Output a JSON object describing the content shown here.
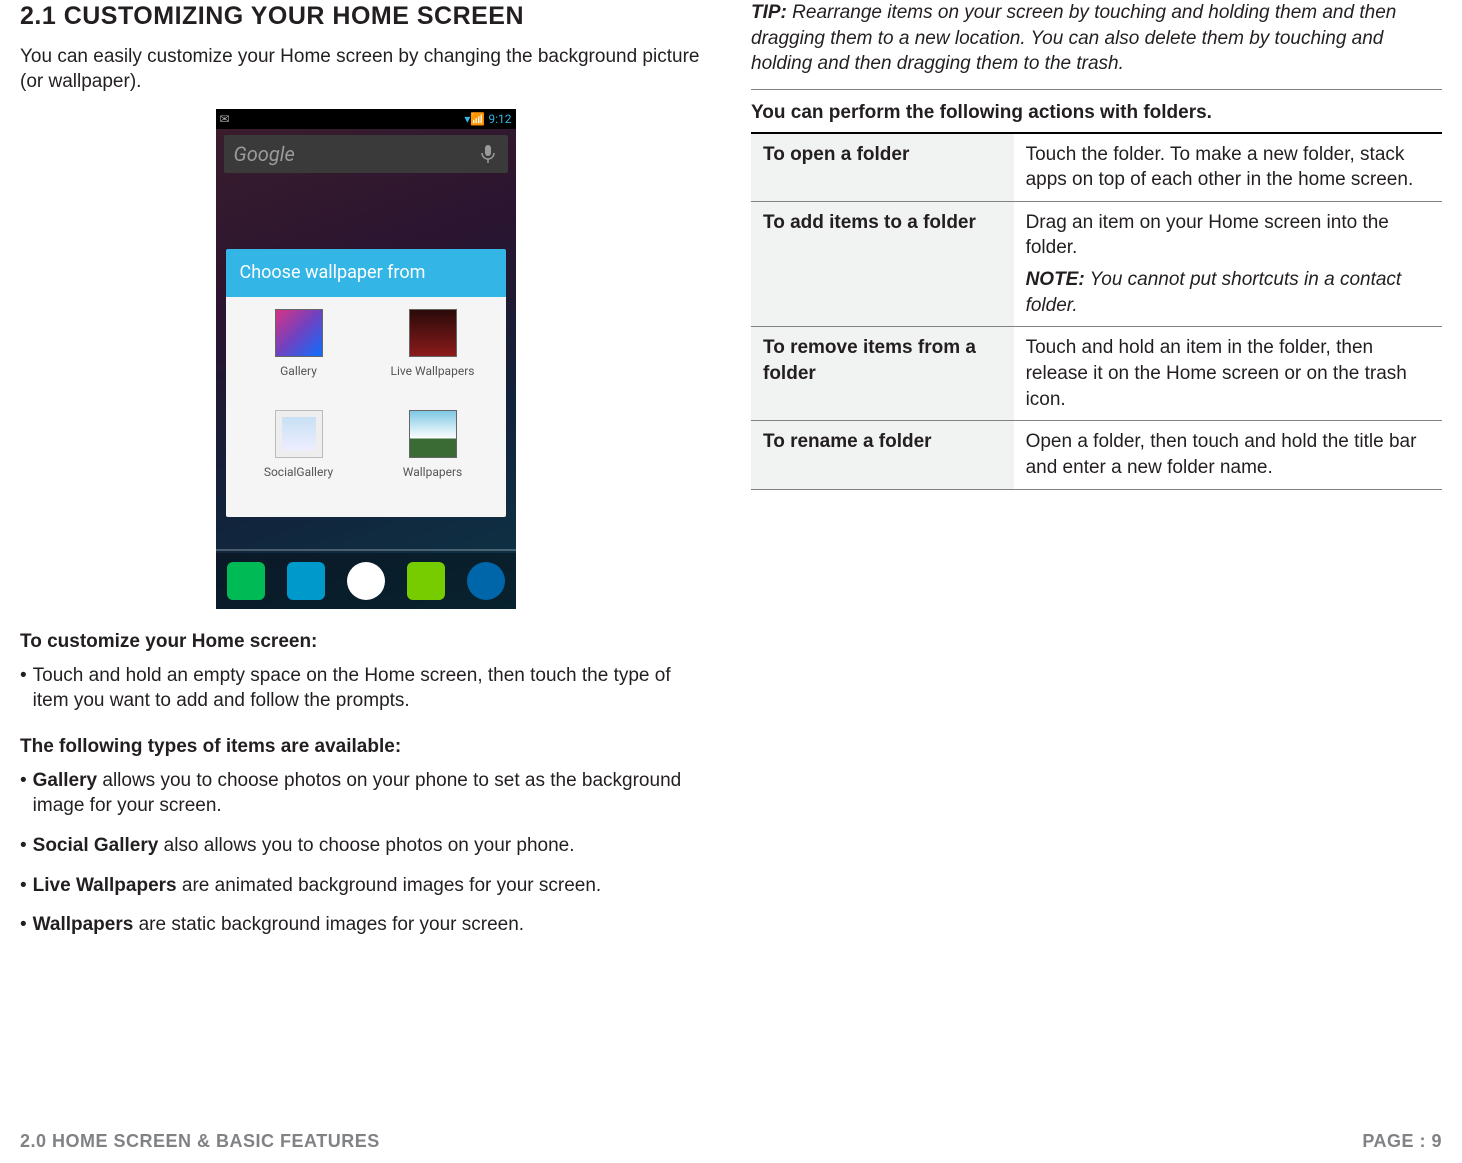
{
  "left": {
    "heading": "2.1 CUSTOMIZING YOUR HOME SCREEN",
    "intro": "You can easily customize your Home screen by changing the background picture (or wallpaper).",
    "customize_lead": "To customize your Home screen:",
    "customize_item": "Touch and hold an empty space on the Home screen, then touch the type of item you want to add and follow the prompts.",
    "types_lead": "The following types of items are available:",
    "types": [
      {
        "bold": "Gallery",
        "rest": " allows you to choose photos on your phone to set as the background image for your screen."
      },
      {
        "bold": "Social Gallery",
        "rest": " also allows you to choose photos on your phone."
      },
      {
        "bold": "Live Wallpapers",
        "rest": " are animated background images for your screen."
      },
      {
        "bold": "Wallpapers",
        "rest": " are static background images for your screen."
      }
    ]
  },
  "phone": {
    "time": "9:12",
    "search_placeholder": "Google",
    "sheet_title": "Choose wallpaper from",
    "options": [
      "Gallery",
      "Live Wallpapers",
      "SocialGallery",
      "Wallpapers"
    ]
  },
  "right": {
    "tip_label": "TIP:",
    "tip_text": " Rearrange items on your screen by touching and holding them and then dragging them to a new location. You can also delete them by touching and holding and then dragging them to the trash.",
    "table_lead": "You can perform the following actions with folders.",
    "rows": [
      {
        "key": "To open a folder",
        "val": "Touch the folder. To make a new folder, stack apps on top of each other in the home screen."
      },
      {
        "key": "To add items to a folder",
        "val": "Drag an item on your Home screen into the folder.",
        "note_label": "NOTE:",
        "note": " You cannot put shortcuts in a contact folder."
      },
      {
        "key": "To remove items from a folder",
        "val": "Touch and hold an item in the folder, then release it on the Home screen or on the trash icon."
      },
      {
        "key": "To rename a folder",
        "val": "Open a folder, then touch and hold the title bar and enter a new folder name."
      }
    ]
  },
  "footer": {
    "left": "2.0 HOME SCREEN & BASIC FEATURES",
    "right": "PAGE : 9"
  }
}
